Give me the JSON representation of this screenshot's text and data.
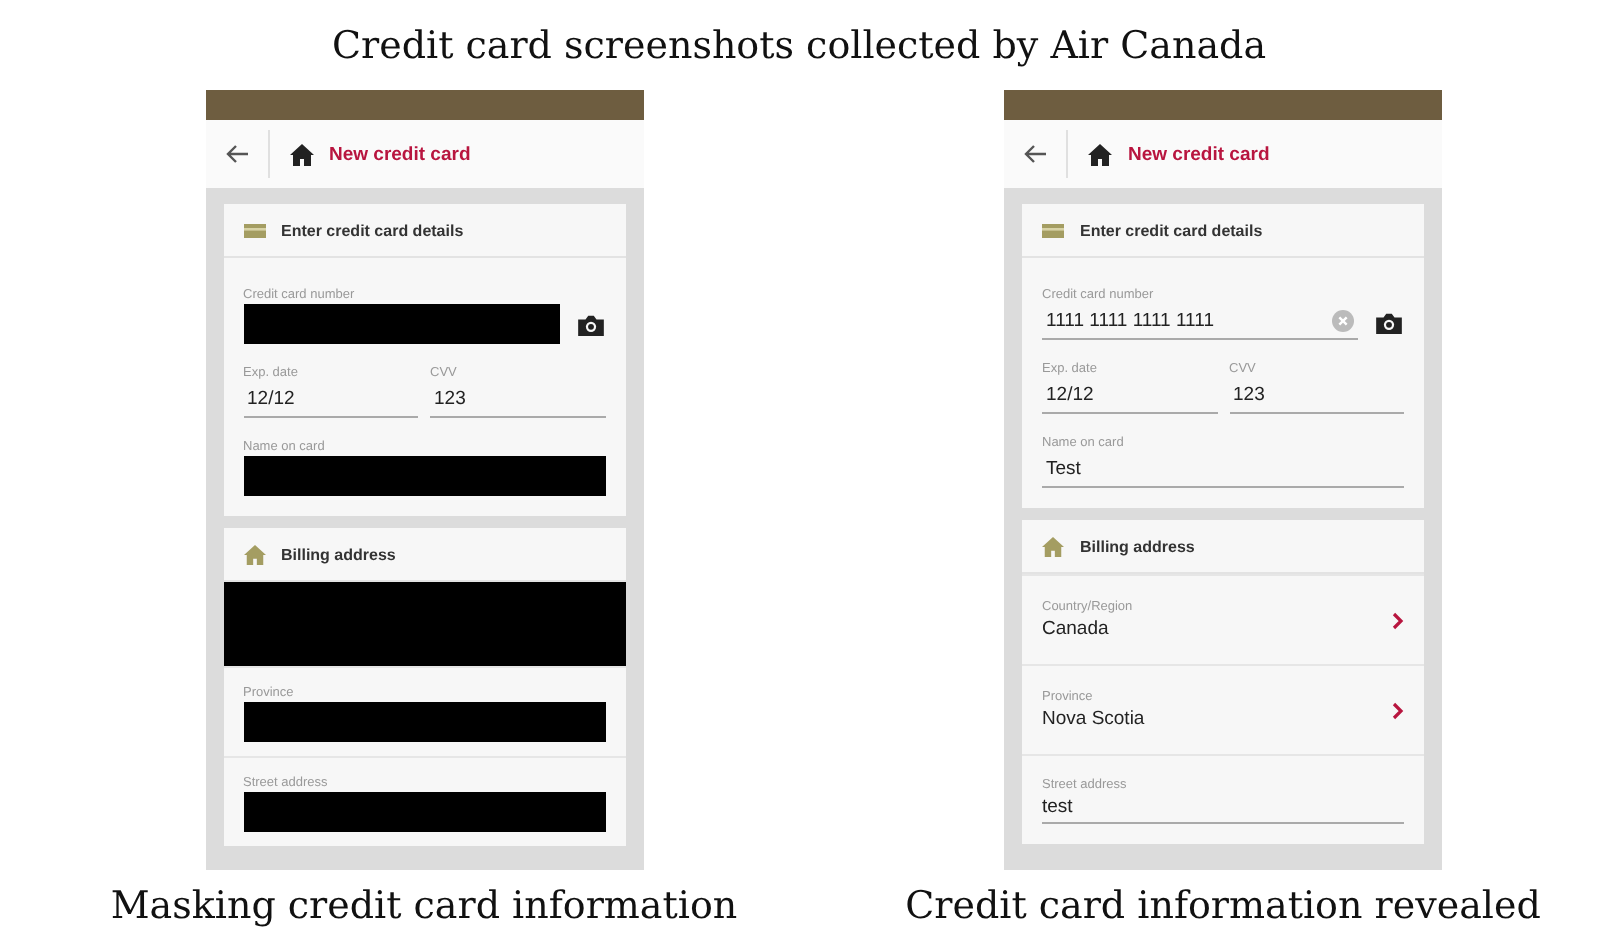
{
  "figure_title": "Credit card screenshots collected by Air Canada",
  "panels": [
    {
      "caption": "Masking credit card information",
      "screen": {
        "header_title": "New credit card",
        "details": {
          "title": "Enter credit card details",
          "fields": [
            {
              "kind": "card_number",
              "label": "Credit card number",
              "masked": true
            },
            {
              "kind": "half",
              "label": "Exp. date",
              "value": "12/12",
              "masked": false
            },
            {
              "kind": "half",
              "label": "CVV",
              "value": "123",
              "masked": false
            },
            {
              "kind": "text",
              "label": "Name on card",
              "masked": true
            }
          ]
        },
        "billing": {
          "title": "Billing address",
          "rows": [
            {
              "kind": "select",
              "masked": true
            },
            {
              "kind": "select",
              "label": "Province",
              "masked": true
            },
            {
              "kind": "text",
              "label": "Street address",
              "masked": true
            }
          ]
        }
      }
    },
    {
      "caption": "Credit card information revealed",
      "screen": {
        "header_title": "New credit card",
        "details": {
          "title": "Enter credit card details",
          "fields": [
            {
              "kind": "card_number",
              "label": "Credit card number",
              "value": "1111 1111 1111 1111",
              "masked": false,
              "clearable": true
            },
            {
              "kind": "half",
              "label": "Exp. date",
              "value": "12/12",
              "masked": false
            },
            {
              "kind": "half",
              "label": "CVV",
              "value": "123",
              "masked": false
            },
            {
              "kind": "text",
              "label": "Name on card",
              "value": "Test",
              "masked": false
            }
          ]
        },
        "billing": {
          "title": "Billing address",
          "rows": [
            {
              "kind": "select",
              "label": "Country/Region",
              "value": "Canada",
              "masked": false
            },
            {
              "kind": "select",
              "label": "Province",
              "value": "Nova Scotia",
              "masked": false
            },
            {
              "kind": "text",
              "label": "Street address",
              "value": "test",
              "masked": false
            }
          ]
        }
      }
    }
  ]
}
